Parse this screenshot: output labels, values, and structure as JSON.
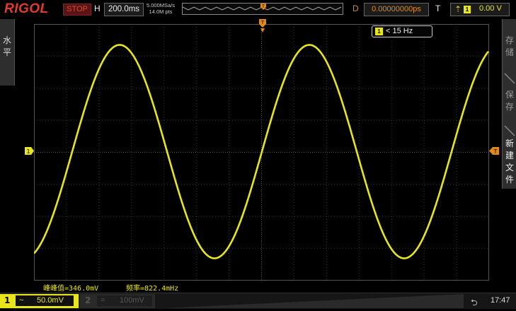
{
  "topbar": {
    "brand": "RIGOL",
    "run_state": "STOP",
    "horizontal_label": "H",
    "timebase": "200.0ms",
    "sample_rate": "5.000MSa/s",
    "memory_depth": "14.0M pts",
    "delay_label": "D",
    "delay_value": "0.00000000ps",
    "trigger_label": "T",
    "trigger_source": "1",
    "trigger_level": "0.00 V",
    "trigger_edge_icon": "rising-edge-icon"
  },
  "left_tab": {
    "label": "水平"
  },
  "right_panel": {
    "items": [
      "存储",
      "保存",
      "新建文件"
    ]
  },
  "screen": {
    "channel_marker": "1",
    "bandwidth_limit": "< 15 Hz",
    "bandwidth_icon_text": "1",
    "trace_color": "#e8e61a",
    "trigger_color": "#e08a1e"
  },
  "measurements": {
    "vpp": "峰峰值=346.0mV",
    "freq": "频率=822.4mHz"
  },
  "bottombar": {
    "ch1_number": "1",
    "ch1_coupling": "~",
    "ch1_scale": "50.0mV",
    "ch2_number": "2",
    "ch2_coupling": "=",
    "ch2_scale": "100mV",
    "time": "17:47",
    "usb_icon": "usb-icon"
  }
}
